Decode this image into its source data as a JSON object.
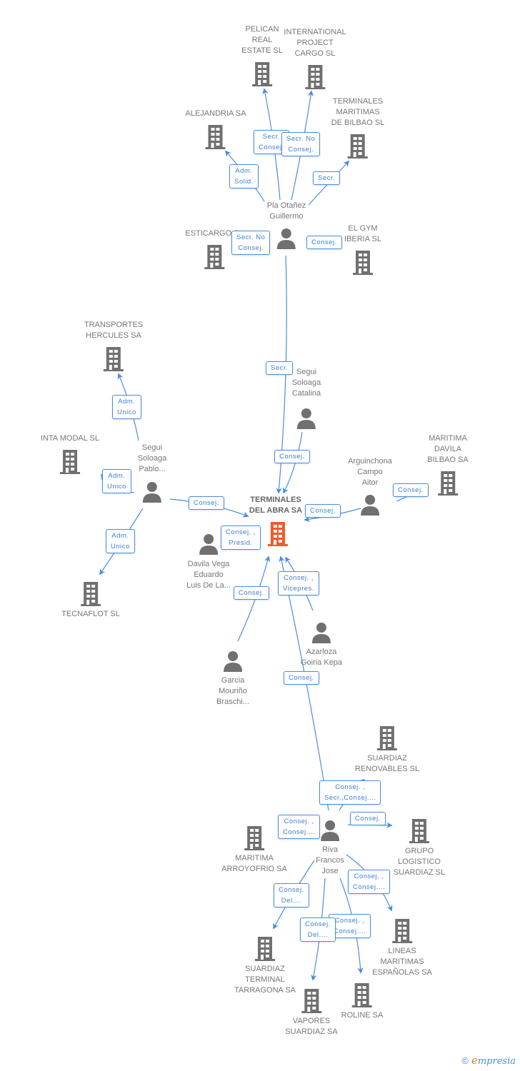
{
  "colors": {
    "edge": "#4a8de0",
    "icon": "#707070",
    "main_icon": "#f05a28",
    "text": "#777777"
  },
  "main_company": {
    "name": "TERMINALES DEL ABRA SA",
    "lines": [
      "TERMINALES",
      "DEL ABRA SA"
    ]
  },
  "companies": [
    {
      "id": "pelican",
      "lines": [
        "PELICAN",
        "REAL",
        "ESTATE SL"
      ]
    },
    {
      "id": "ipc",
      "lines": [
        "INTERNATIONAL",
        "PROJECT",
        "CARGO SL"
      ]
    },
    {
      "id": "alejandria",
      "lines": [
        "ALEJANDRIA SA"
      ]
    },
    {
      "id": "tmb",
      "lines": [
        "TERMINALES",
        "MARITIMAS",
        "DE BILBAO SL"
      ]
    },
    {
      "id": "esticargo",
      "lines": [
        "ESTICARGO SL"
      ]
    },
    {
      "id": "elgym",
      "lines": [
        "EL GYM",
        "IBERIA  SL"
      ]
    },
    {
      "id": "hercules",
      "lines": [
        "TRANSPORTES",
        "HERCULES SA"
      ]
    },
    {
      "id": "intamodal",
      "lines": [
        "INTA MODAL SL"
      ]
    },
    {
      "id": "maritimadavila",
      "lines": [
        "MARITIMA",
        "DAVILA",
        "BILBAO SA"
      ]
    },
    {
      "id": "tecnaflot",
      "lines": [
        "TECNAFLOT SL"
      ]
    },
    {
      "id": "renovables",
      "lines": [
        "SUARDIAZ",
        "RENOVABLES SL"
      ]
    },
    {
      "id": "arroyofrio",
      "lines": [
        "MARITIMA",
        "ARROYOFRIO SA"
      ]
    },
    {
      "id": "grupo",
      "lines": [
        "GRUPO",
        "LOGISTICO",
        "SUARDIAZ SL"
      ]
    },
    {
      "id": "lineas",
      "lines": [
        "LINEAS",
        "MARITIMAS",
        "ESPAÑOLAS SA"
      ]
    },
    {
      "id": "tarragona",
      "lines": [
        "SUARDIAZ",
        "TERMINAL",
        "TARRAGONA SA"
      ]
    },
    {
      "id": "vapores",
      "lines": [
        "VAPORES",
        "SUARDIAZ SA"
      ]
    },
    {
      "id": "roline",
      "lines": [
        "ROLINE SA"
      ]
    }
  ],
  "people": [
    {
      "id": "pla",
      "lines": [
        "Pla Otañez",
        "Guillermo"
      ]
    },
    {
      "id": "seguicat",
      "lines": [
        "Segui",
        "Soloaga",
        "Catalina"
      ]
    },
    {
      "id": "seguipab",
      "lines": [
        "Segui",
        "Soloaga",
        "Pablo..."
      ]
    },
    {
      "id": "arguinchona",
      "lines": [
        "Arguinchona",
        "Campo",
        "Aitor"
      ]
    },
    {
      "id": "davila",
      "lines": [
        "Davila Vega",
        "Eduardo",
        "Luis De La..."
      ]
    },
    {
      "id": "azarloza",
      "lines": [
        "Azarloza",
        "Goiria Kepa"
      ]
    },
    {
      "id": "garcia",
      "lines": [
        "Garcia",
        "Mouriño",
        "Braschi..."
      ]
    },
    {
      "id": "riva",
      "lines": [
        "Riva",
        "Francos",
        "Jose"
      ]
    }
  ],
  "relations": [
    {
      "from": "pla",
      "to": "pelican",
      "label": [
        "Secr.",
        "Consej."
      ]
    },
    {
      "from": "pla",
      "to": "ipc",
      "label": [
        "Secr.  No",
        "Consej."
      ]
    },
    {
      "from": "pla",
      "to": "alejandria",
      "label": [
        "Adm.",
        "Solid."
      ]
    },
    {
      "from": "pla",
      "to": "tmb",
      "label": [
        "Secr."
      ]
    },
    {
      "from": "pla",
      "to": "esticargo",
      "label": [
        "Secr.  No",
        "Consej."
      ]
    },
    {
      "from": "pla",
      "to": "elgym",
      "label": [
        "Consej."
      ]
    },
    {
      "from": "pla",
      "to": "main",
      "label": [
        "Secr."
      ]
    },
    {
      "from": "seguicat",
      "to": "main",
      "label": [
        "Consej."
      ]
    },
    {
      "from": "seguipab",
      "to": "hercules",
      "label": [
        "Adm.",
        "Unico"
      ]
    },
    {
      "from": "seguipab",
      "to": "intamodal",
      "label": [
        "Adm.",
        "Unico"
      ]
    },
    {
      "from": "seguipab",
      "to": "tecnaflot",
      "label": [
        "Adm.",
        "Unico"
      ]
    },
    {
      "from": "seguipab",
      "to": "main",
      "label": [
        "Consej."
      ]
    },
    {
      "from": "arguinchona",
      "to": "main",
      "label": [
        "Consej."
      ]
    },
    {
      "from": "arguinchona",
      "to": "maritimadavila",
      "label": [
        "Consej."
      ]
    },
    {
      "from": "davila",
      "to": "main",
      "label": [
        "Consej. ,",
        "Presid."
      ]
    },
    {
      "from": "garcia",
      "to": "main",
      "label": [
        "Consej."
      ]
    },
    {
      "from": "azarloza",
      "to": "main",
      "label": [
        "Consej. ,",
        "Vicepres."
      ]
    },
    {
      "from": "riva",
      "to": "main",
      "label": [
        "Consej."
      ]
    },
    {
      "from": "riva",
      "to": "renovables",
      "label": [
        "Consej. ,",
        "Secr.,Consej...."
      ]
    },
    {
      "from": "riva",
      "to": "arroyofrio",
      "label": [
        "Consej. ,",
        "Consej...."
      ]
    },
    {
      "from": "riva",
      "to": "grupo",
      "label": [
        "Consej."
      ]
    },
    {
      "from": "riva",
      "to": "lineas",
      "label": [
        "Consej. ,",
        "Consej...."
      ]
    },
    {
      "from": "riva",
      "to": "tarragona",
      "label": [
        "Consej.",
        "Del...."
      ]
    },
    {
      "from": "riva",
      "to": "vapores",
      "label": [
        "Consej.",
        "Del...."
      ]
    },
    {
      "from": "riva",
      "to": "roline",
      "label": [
        "Consej. ,",
        "Consej...."
      ]
    }
  ],
  "branding": {
    "copyright": "©",
    "logo_initial": "e",
    "logo_rest": "mpresia"
  }
}
